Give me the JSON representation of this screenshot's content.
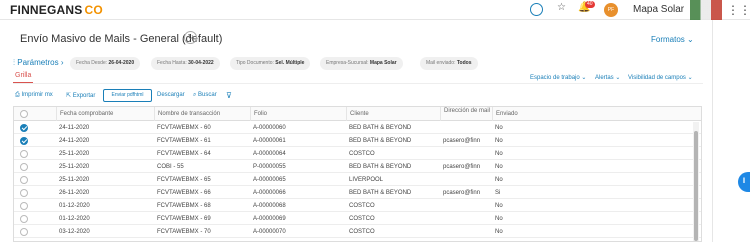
{
  "topbar": {
    "logo_text": "FINNEGANS",
    "logo_co": "CO",
    "badge_count": "40",
    "avatar_initials": "PF",
    "company": "Mapa Solar"
  },
  "page": {
    "title": "Envío Masivo de Mails - General (default)",
    "formatos": "Formatos"
  },
  "params": {
    "toggle": "Parámetros",
    "chips": [
      {
        "label": "Fecha Desde:",
        "value": "26-04-2020"
      },
      {
        "label": "Fecha Hasta:",
        "value": "30-04-2022"
      },
      {
        "label": "Tipo Documento:",
        "value": "Sel. Múltiple"
      },
      {
        "label": "Empresa-Sucursal:",
        "value": "Mapa Solar"
      },
      {
        "label": "Mail enviado:",
        "value": "Todos"
      }
    ]
  },
  "tabs": {
    "grilla": "Grilla"
  },
  "view_options": {
    "espacio": "Espacio de trabajo",
    "alertas": "Alertas",
    "visibilidad": "Visibilidad de campos"
  },
  "toolbar": {
    "imprimir": "Imprimir mx",
    "exportar": "Exportar",
    "enviar": "Enviar pdfhtml",
    "descargar": "Descargar",
    "buscar": "Buscar"
  },
  "grid": {
    "headers": [
      "Fecha comprobante",
      "Nombre de transacción",
      "Folio",
      "Cliente",
      "Dirección de mail",
      "Enviado"
    ],
    "rows": [
      {
        "checked": true,
        "fecha": "24-11-2020",
        "nombre": "FCVTAWEBMX - 60",
        "folio": "A-00000060",
        "cliente": "BED BATH & BEYOND",
        "mail": "",
        "enviado": "No"
      },
      {
        "checked": true,
        "fecha": "24-11-2020",
        "nombre": "FCVTAWEBMX - 61",
        "folio": "A-00000061",
        "cliente": "BED BATH & BEYOND",
        "mail": "pcasero@finn",
        "enviado": "No"
      },
      {
        "checked": false,
        "fecha": "25-11-2020",
        "nombre": "FCVTAWEBMX - 64",
        "folio": "A-00000064",
        "cliente": "COSTCO",
        "mail": "",
        "enviado": "No"
      },
      {
        "checked": false,
        "fecha": "25-11-2020",
        "nombre": "COBI - 55",
        "folio": "P-00000055",
        "cliente": "BED BATH & BEYOND",
        "mail": "pcasero@finn",
        "enviado": "No"
      },
      {
        "checked": false,
        "fecha": "25-11-2020",
        "nombre": "FCVTAWEBMX - 65",
        "folio": "A-00000065",
        "cliente": "LIVERPOOL",
        "mail": "",
        "enviado": "No"
      },
      {
        "checked": false,
        "fecha": "26-11-2020",
        "nombre": "FCVTAWEBMX - 66",
        "folio": "A-00000066",
        "cliente": "BED BATH & BEYOND",
        "mail": "pcasero@finn",
        "enviado": "Si"
      },
      {
        "checked": false,
        "fecha": "01-12-2020",
        "nombre": "FCVTAWEBMX - 68",
        "folio": "A-00000068",
        "cliente": "COSTCO",
        "mail": "",
        "enviado": "No"
      },
      {
        "checked": false,
        "fecha": "01-12-2020",
        "nombre": "FCVTAWEBMX - 69",
        "folio": "A-00000069",
        "cliente": "COSTCO",
        "mail": "",
        "enviado": "No"
      },
      {
        "checked": false,
        "fecha": "03-12-2020",
        "nombre": "FCVTAWEBMX - 70",
        "folio": "A-00000070",
        "cliente": "COSTCO",
        "mail": "",
        "enviado": "No"
      }
    ]
  },
  "colors": {
    "accent": "#1a7fb8",
    "tab_active": "#d9534f",
    "brand_orange": "#f39200"
  }
}
